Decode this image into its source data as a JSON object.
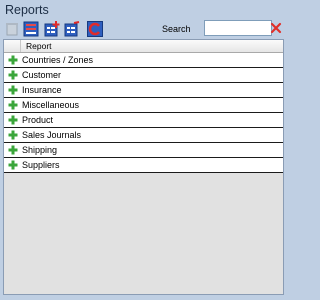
{
  "title": "Reports",
  "toolbar": {
    "buttons": [
      {
        "name": "delete-report-button",
        "icon": "delete-icon",
        "disabled": true
      },
      {
        "name": "report-list-button",
        "icon": "report-list-icon",
        "disabled": false
      },
      {
        "name": "add-group-button",
        "icon": "add-group-icon",
        "disabled": false
      },
      {
        "name": "edit-group-button",
        "icon": "edit-group-icon",
        "disabled": false
      },
      {
        "name": "refresh-button",
        "icon": "refresh-icon",
        "disabled": false
      }
    ],
    "search_label": "Search",
    "search_value": "",
    "clear_icon": "close-icon"
  },
  "grid": {
    "column_header": "Report",
    "rows": [
      {
        "label": "Countries / Zones",
        "icon": "expand-plus-icon"
      },
      {
        "label": "Customer",
        "icon": "expand-plus-icon"
      },
      {
        "label": "Insurance",
        "icon": "expand-plus-icon"
      },
      {
        "label": "Miscellaneous",
        "icon": "expand-plus-icon"
      },
      {
        "label": "Product",
        "icon": "expand-plus-icon"
      },
      {
        "label": "Sales Journals",
        "icon": "expand-plus-icon"
      },
      {
        "label": "Shipping",
        "icon": "expand-plus-icon"
      },
      {
        "label": "Suppliers",
        "icon": "expand-plus-icon"
      }
    ]
  },
  "colors": {
    "background": "#bfcfe3",
    "grid_background": "#e1e1e1",
    "plus_green": "#3aa63a",
    "clear_red": "#e0302a"
  }
}
